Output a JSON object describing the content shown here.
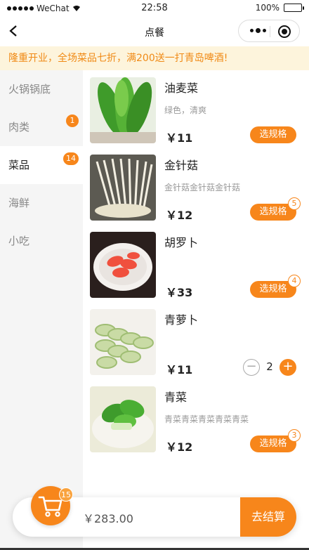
{
  "status_bar": {
    "carrier": "WeChat",
    "time": "22:58",
    "battery": "100%"
  },
  "nav": {
    "title": "点餐",
    "back_icon": "chevron-left-icon",
    "more_icon": "more-dots-icon",
    "close_icon": "target-close-icon"
  },
  "notice": "隆重开业，全场菜品七折，满200送一打青岛啤酒!",
  "categories": [
    {
      "label": "火锅锅底",
      "badge": ""
    },
    {
      "label": "肉类",
      "badge": "1"
    },
    {
      "label": "菜品",
      "badge": "14",
      "active": true
    },
    {
      "label": "海鲜",
      "badge": ""
    },
    {
      "label": "小吃",
      "badge": ""
    }
  ],
  "products": [
    {
      "name": "油麦菜",
      "desc": "绿色，清爽",
      "price": "￥11",
      "action": "选规格",
      "count": ""
    },
    {
      "name": "金针菇",
      "desc": "金针菇金针菇金针菇",
      "price": "￥12",
      "action": "选规格",
      "count": "5"
    },
    {
      "name": "胡罗卜",
      "desc": "",
      "price": "￥33",
      "action": "选规格",
      "count": "4"
    },
    {
      "name": "青萝卜",
      "desc": "",
      "price": "￥11",
      "minus": "−",
      "qty": "2",
      "plus": "+"
    },
    {
      "name": "青菜",
      "desc": "青菜青菜青菜青菜青菜",
      "price": "￥12",
      "action": "选规格",
      "count": "3"
    }
  ],
  "cart": {
    "count": "15",
    "total": "￥283.00",
    "checkout": "去结算",
    "icon": "shopping-cart-icon"
  },
  "colors": {
    "accent": "#f7861b",
    "notice_bg": "#fdf4dc",
    "sidebar_bg": "#f5f5f5"
  }
}
